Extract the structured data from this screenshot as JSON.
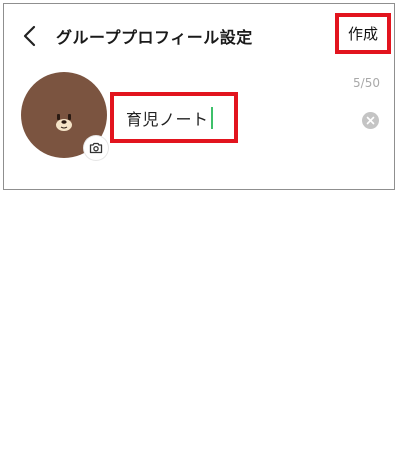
{
  "header": {
    "title": "グループプロフィール設定",
    "create_label": "作成"
  },
  "profile": {
    "name_value": "育児ノート",
    "char_counter": "5/50"
  },
  "icons": {
    "back": "chevron-left-icon",
    "camera": "camera-icon",
    "clear": "clear-circle-icon",
    "avatar": "brown-bear-avatar"
  },
  "colors": {
    "highlight_border": "#e2141e",
    "caret": "#3ec06a",
    "avatar_brown": "#7b5440",
    "counter_gray": "#a9a9a9"
  }
}
